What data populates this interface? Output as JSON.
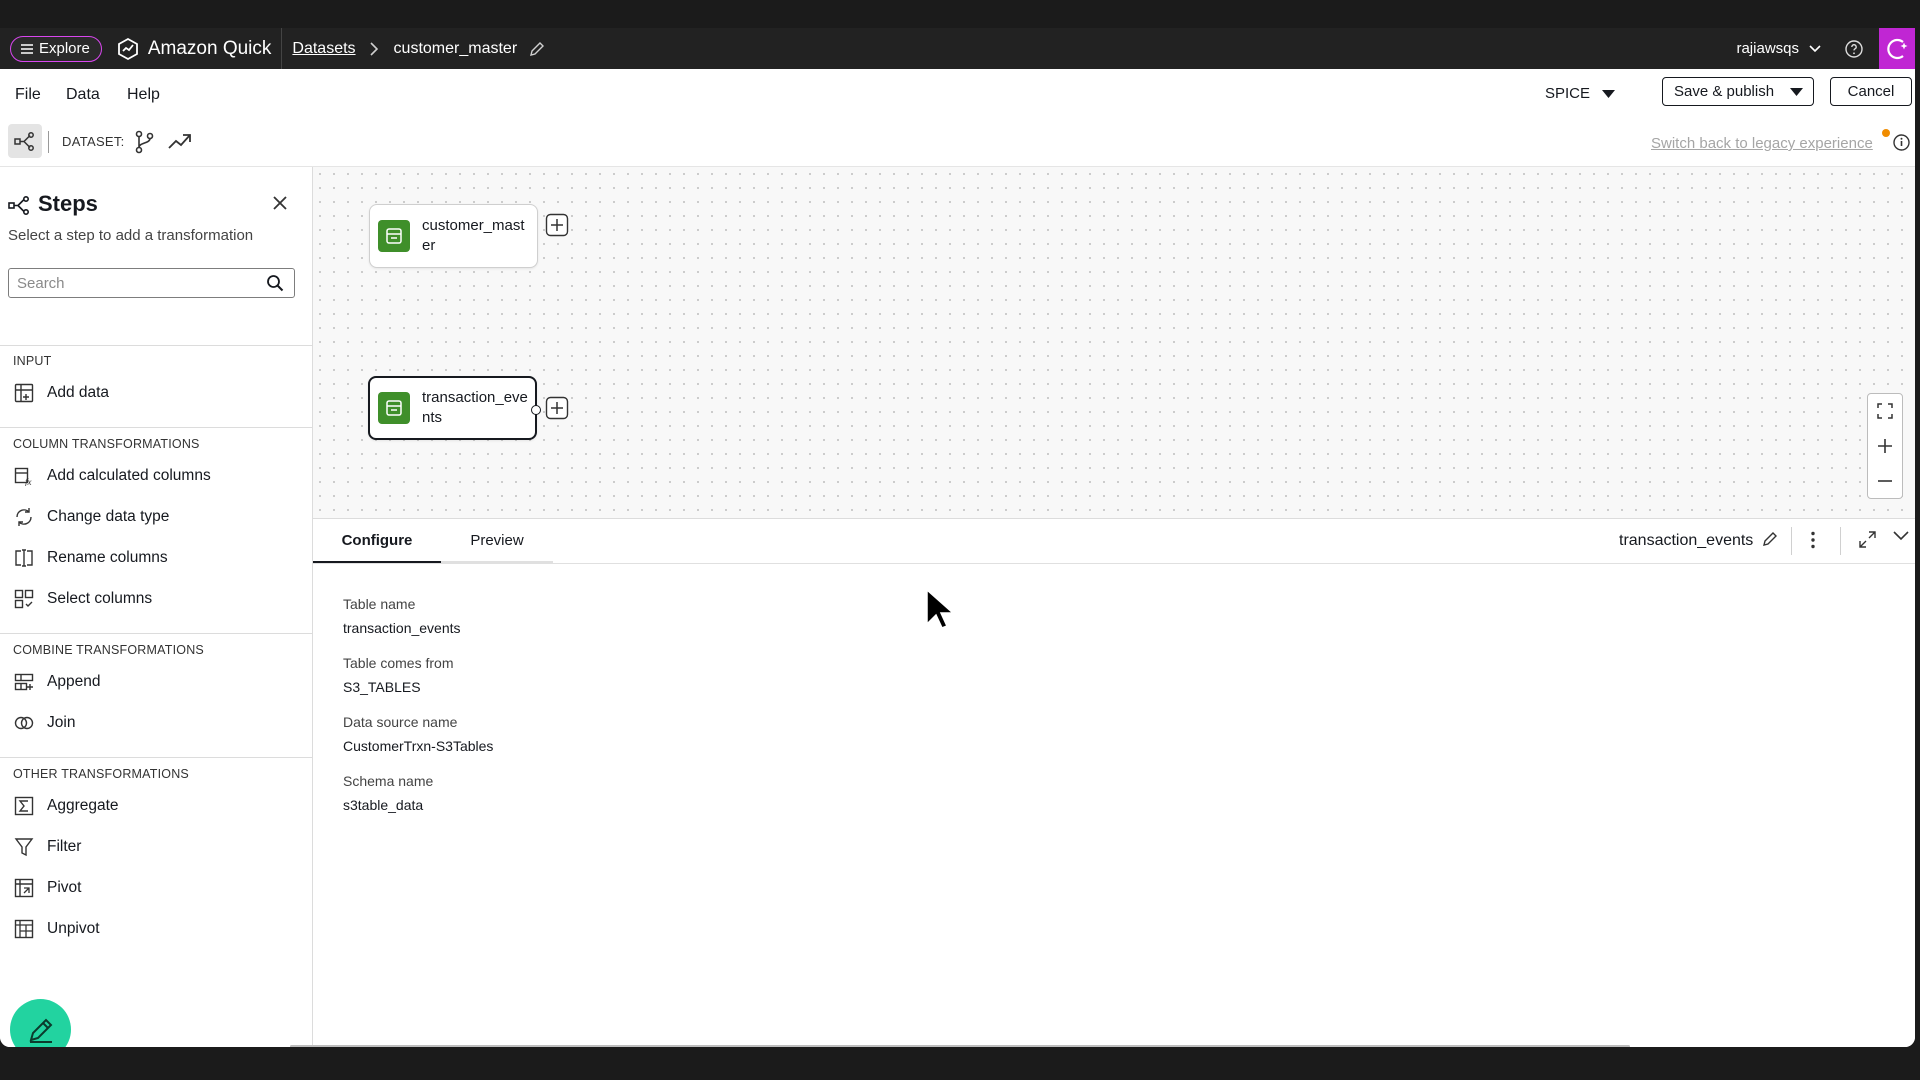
{
  "topbar": {
    "explore_label": "Explore",
    "brand": "Amazon Quick",
    "breadcrumb_datasets": "Datasets",
    "breadcrumb_current": "customer_master",
    "user": "rajiawsqs"
  },
  "menubar": {
    "items": [
      "File",
      "Data",
      "Help"
    ],
    "storage_mode": "SPICE",
    "save_publish_label": "Save & publish",
    "cancel_label": "Cancel"
  },
  "toolbar": {
    "dataset_label": "DATASET:",
    "legacy_link": "Switch back to legacy experience"
  },
  "sidebar": {
    "title": "Steps",
    "subtitle": "Select a step to add a transformation",
    "search_placeholder": "Search",
    "sections": [
      {
        "title": "INPUT",
        "items": [
          {
            "label": "Add data",
            "icon": "table-add-icon"
          }
        ]
      },
      {
        "title": "COLUMN TRANSFORMATIONS",
        "items": [
          {
            "label": "Add calculated columns",
            "icon": "calculated-column-icon"
          },
          {
            "label": "Change data type",
            "icon": "data-type-icon"
          },
          {
            "label": "Rename columns",
            "icon": "rename-icon"
          },
          {
            "label": "Select columns",
            "icon": "select-columns-icon"
          }
        ]
      },
      {
        "title": "COMBINE TRANSFORMATIONS",
        "items": [
          {
            "label": "Append",
            "icon": "append-icon"
          },
          {
            "label": "Join",
            "icon": "join-icon"
          }
        ]
      },
      {
        "title": "OTHER TRANSFORMATIONS",
        "items": [
          {
            "label": "Aggregate",
            "icon": "sigma-icon"
          },
          {
            "label": "Filter",
            "icon": "filter-icon"
          },
          {
            "label": "Pivot",
            "icon": "pivot-icon"
          },
          {
            "label": "Unpivot",
            "icon": "unpivot-icon"
          }
        ]
      }
    ]
  },
  "canvas": {
    "nodes": [
      {
        "label": "customer_master",
        "selected": false
      },
      {
        "label": "transaction_events",
        "selected": true
      }
    ]
  },
  "panel": {
    "tabs": [
      "Configure",
      "Preview"
    ],
    "active_tab": "Configure",
    "title": "transaction_events",
    "fields": [
      {
        "label": "Table name",
        "value": "transaction_events"
      },
      {
        "label": "Table comes from",
        "value": "S3_TABLES"
      },
      {
        "label": "Data source name",
        "value": "CustomerTrxn-S3Tables"
      },
      {
        "label": "Schema name",
        "value": "s3table_data"
      }
    ]
  },
  "colors": {
    "accent_explore": "#d946ef",
    "node_icon": "#3f8f2a",
    "fab": "#22d3a0",
    "legacy_dot": "#f08c00"
  }
}
